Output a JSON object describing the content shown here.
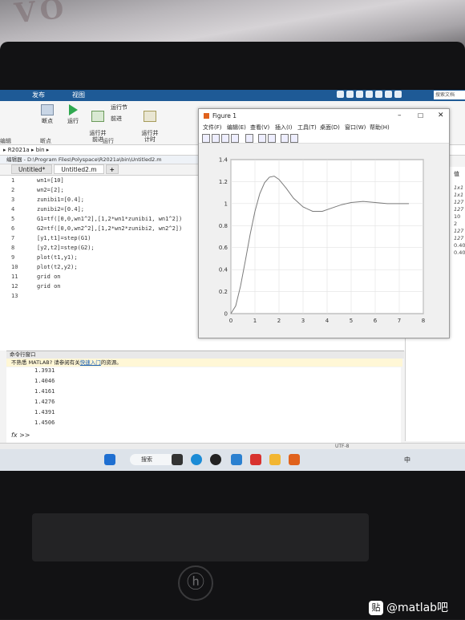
{
  "ribbon": {
    "tabs": [
      "发布",
      "视图"
    ],
    "search_placeholder": "搜索文档",
    "buttons": {
      "breakpoint": "断点",
      "run": "运行",
      "run_advance": "运行并\n前进",
      "run_section": "运行节",
      "advance": "前进",
      "run_time": "运行并\n计时"
    },
    "groups": {
      "breakpoints": "断点",
      "run": "运行",
      "edit": "编辑"
    }
  },
  "path": {
    "parts": [
      "R2021a",
      "bin"
    ]
  },
  "editor": {
    "title": "编辑器 - D:\\Program Files\\Polyspace\\R2021a\\bin\\Untitled2.m",
    "tabs": [
      "Untitled*",
      "Untitled2.m",
      "+"
    ],
    "lines": [
      {
        "num": "1",
        "text": "wn1=[10]"
      },
      {
        "num": "2",
        "text": "wn2=[2];"
      },
      {
        "num": "3",
        "text": "zunibi1=[0.4];"
      },
      {
        "num": "4",
        "text": "zunibi2=[0.4];"
      },
      {
        "num": "5",
        "text": "G1=tf([0,0,wn1^2],[1,2*wn1*zunibi1, wn1^2])"
      },
      {
        "num": "6",
        "text": "G2=tf([0,0,wn2^2],[1,2*wn2*zunibi2, wn2^2])"
      },
      {
        "num": "7",
        "text": "[y1,t1]=step(G1)"
      },
      {
        "num": "8",
        "text": "[y2,t2]=step(G2);"
      },
      {
        "num": "9",
        "text": "plot(t1,y1);"
      },
      {
        "num": "10",
        "text": "plot(t2,y2);"
      },
      {
        "num": "11",
        "text": "grid on"
      },
      {
        "num": "12",
        "text": "grid on"
      },
      {
        "num": "13",
        "text": ""
      }
    ]
  },
  "command_window": {
    "title": "命令行窗口",
    "notice_prefix": "不熟悉 MATLAB? 请参阅有关",
    "notice_link": "快速入门",
    "notice_suffix": "的资源。",
    "outputs": [
      "1.3931",
      "1.4046",
      "1.4161",
      "1.4276",
      "1.4391",
      "1.4506"
    ],
    "prompt": "fx >>"
  },
  "workspace": {
    "header": "值",
    "values": [
      "1x1",
      "1x1",
      "127",
      "127",
      "10",
      "2",
      "127",
      "127",
      "0.400",
      "0.400"
    ]
  },
  "status": {
    "encoding": "UTF-8"
  },
  "taskbar": {
    "search_label": "搜索",
    "tray_text": "中"
  },
  "figure": {
    "title": "Figure 1",
    "menu": [
      "文件(F)",
      "编辑(E)",
      "查看(V)",
      "插入(I)",
      "工具(T)",
      "桌面(D)",
      "窗口(W)",
      "帮助(H)"
    ]
  },
  "chart_data": {
    "type": "line",
    "title": "",
    "xlabel": "",
    "ylabel": "",
    "xlim": [
      0,
      8
    ],
    "ylim": [
      0,
      1.4
    ],
    "xticks": [
      0,
      1,
      2,
      3,
      4,
      5,
      6,
      7,
      8
    ],
    "yticks": [
      0,
      0.2,
      0.4,
      0.6,
      0.8,
      1,
      1.2,
      1.4
    ],
    "grid": true,
    "series": [
      {
        "color": "#7a7a7a",
        "x": [
          0,
          0.2,
          0.4,
          0.6,
          0.8,
          1.0,
          1.2,
          1.4,
          1.6,
          1.8,
          2.0,
          2.3,
          2.6,
          3.0,
          3.4,
          3.8,
          4.2,
          4.6,
          5.0,
          5.5,
          6.0,
          6.5,
          7.0,
          7.4
        ],
        "y": [
          0,
          0.07,
          0.25,
          0.48,
          0.72,
          0.93,
          1.09,
          1.19,
          1.24,
          1.25,
          1.22,
          1.14,
          1.05,
          0.97,
          0.93,
          0.93,
          0.96,
          0.99,
          1.01,
          1.02,
          1.01,
          1.0,
          1.0,
          1.0
        ]
      }
    ]
  },
  "watermark": {
    "badge": "贴",
    "text": "@matlab吧"
  },
  "background": {
    "cloth_text": "VO"
  }
}
